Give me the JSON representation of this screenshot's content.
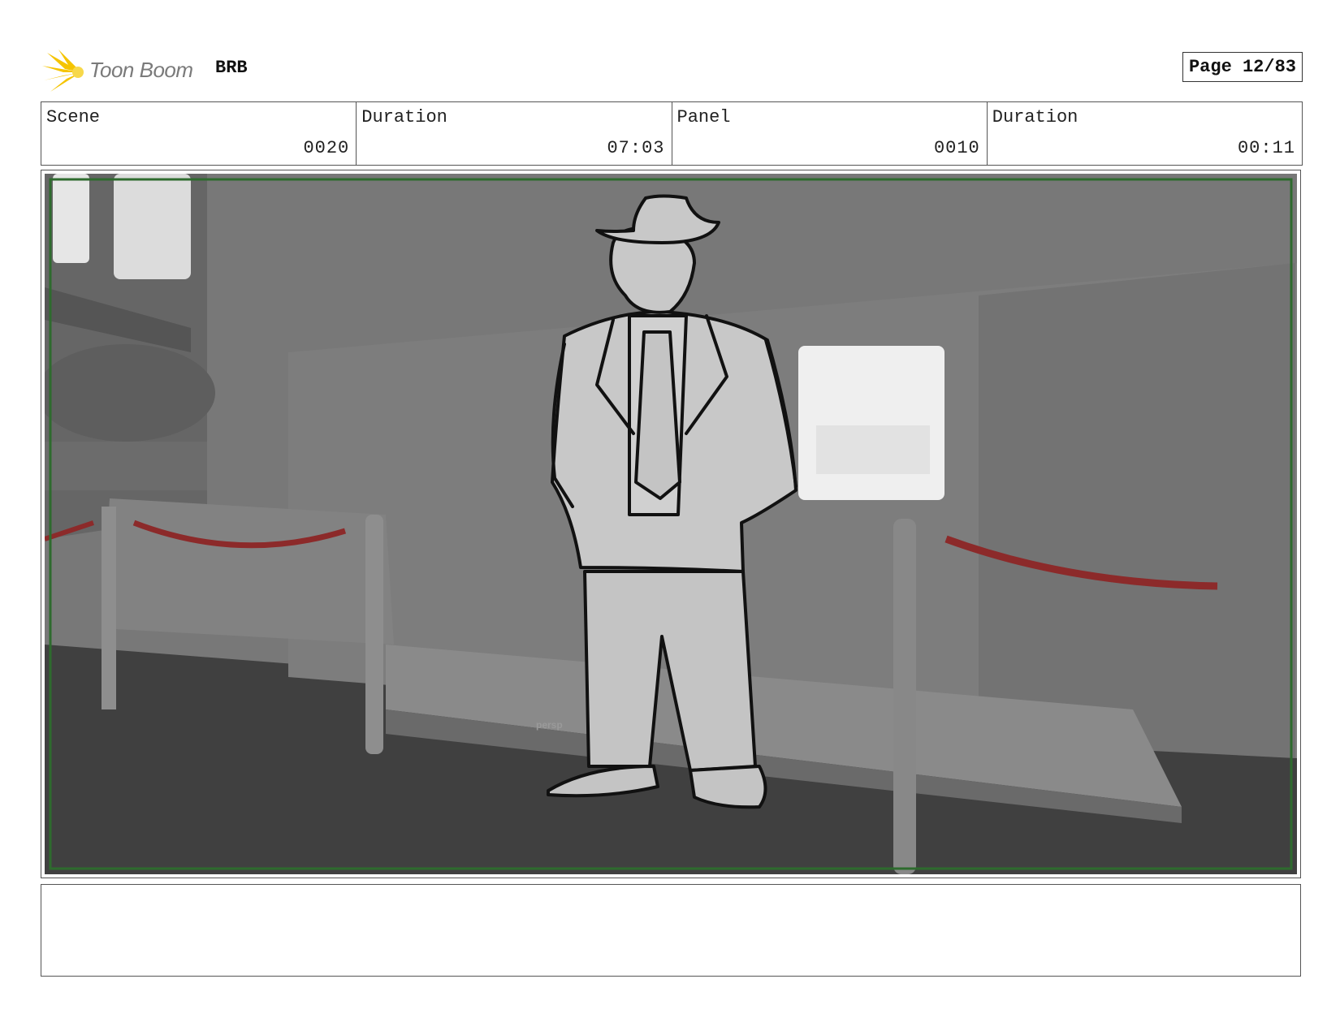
{
  "header": {
    "brand": "Toon Boom",
    "project": "BRB",
    "page": "Page 12/83"
  },
  "info": {
    "scene_label": "Scene",
    "scene_value": "0020",
    "duration_label": "Duration",
    "duration_value": "07:03",
    "panel_label": "Panel",
    "panel_value": "0010",
    "panel_duration_label": "Duration",
    "panel_duration_value": "00:11"
  },
  "panel": {
    "viewport_label": "persp"
  },
  "notes": {
    "text": ""
  },
  "colors": {
    "logo_accent": "#f5c400",
    "safe_frame": "#2e6b2e",
    "rope": "#8c2a2a"
  }
}
